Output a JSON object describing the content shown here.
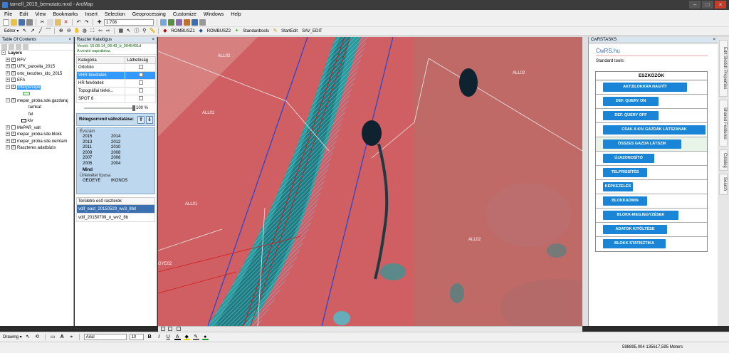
{
  "window": {
    "title": "tarnell_2015_bemutato.mxd - ArcMap"
  },
  "menu": [
    "File",
    "Edit",
    "View",
    "Bookmarks",
    "Insert",
    "Selection",
    "Geoprocessing",
    "Customize",
    "Windows",
    "Help"
  ],
  "toolbar": {
    "scale": "1:708",
    "editor_label": "Editor ▾",
    "rombusz1": "ROMBUSZ1",
    "rombusz2": "ROMBUSZ2",
    "standardtools": "Standardtools",
    "startedit": "StartEdit",
    "sav_edit": "SAV_EDIT"
  },
  "toc": {
    "title": "Table Of Contents",
    "layers_root": "Layers",
    "items": [
      {
        "label": "RFV",
        "checked": true
      },
      {
        "label": "UFK_parcella_2015",
        "checked": true
      },
      {
        "label": "orto_keszites_ido_2015",
        "checked": true
      },
      {
        "label": "EFA",
        "checked": true
      },
      {
        "label": "interpshape",
        "checked": true,
        "selected": true
      },
      {
        "label": "mepar_proba.sde.gazdaraj",
        "checked": true
      },
      {
        "label": "tamkat",
        "indent": true
      },
      {
        "label": "fel",
        "indent": true
      },
      {
        "label": "kiv",
        "indent": true
      },
      {
        "label": "MePAR_valt",
        "checked": true
      },
      {
        "label": "mepar_proba.sde.blokk",
        "checked": true
      },
      {
        "label": "mepar_proba.sde.nemtam",
        "checked": true
      },
      {
        "label": "Raszteres adatbázis",
        "checked": true
      }
    ]
  },
  "catalog": {
    "title": "Raszter Katalógus",
    "version_line1": "Verzió: 15.08.14_08:43_b_9945491d",
    "version_line2": "A verzió naprakész.",
    "col_category": "Kategória",
    "col_visibility": "Láthetóság",
    "rows": [
      {
        "label": "Ortofoto",
        "selected": false
      },
      {
        "label": "VHR felvételek",
        "selected": true
      },
      {
        "label": "HR felvételek",
        "selected": false
      },
      {
        "label": "Topográfiai térké...",
        "selected": false
      },
      {
        "label": "SPOT 6",
        "selected": false
      }
    ],
    "opacity": "100 %",
    "order_title": "Rétegsorrend változtatása:",
    "year_header": "Évszám",
    "years": [
      "2015",
      "2014",
      "2013",
      "2012",
      "2011",
      "2010",
      "2009",
      "2008",
      "2007",
      "2006",
      "2005",
      "2004"
    ],
    "mind": "Mind",
    "type_header": "Ürfelvétel típusa",
    "types": [
      "GEOEYE",
      "IKONOS"
    ],
    "rasters_title": "Területre eső raszterek",
    "rasters": [
      {
        "label": "vdif_east_20150529_wv3_8bit",
        "selected": true
      },
      {
        "label": "vdif_20150709_o_wv2_8b",
        "selected": false
      }
    ]
  },
  "map": {
    "labels": [
      "ALL02",
      "ALL02",
      "ALL02",
      "ALL01",
      "ALL02",
      "GYE02"
    ]
  },
  "cwrs": {
    "title": "CwRSTASKS",
    "brand": "CwRS.hu",
    "standard_tools": "Standard tools:",
    "tools_header": "ESZKÖZÖK",
    "buttons": [
      "AKT.BLOKKRA NAGYÍT",
      "DEF. QUERY ON",
      "DEF. QUERY OFF",
      "CSAK A KIV GAZDÁK LÁTSZANAK",
      "ÖSSZES GAZDA LÁTSZIK",
      "ÚJAZONOSÍTÓ",
      "TELFRISSÍTÉS",
      "KÉPKEZELÉS",
      "BLOKKADMIN",
      "BLOKK-MEGJEGYZÉSEK",
      "ADATOK KITÖLTÉSE",
      "BLOKK STATISZTIKA"
    ]
  },
  "side_tabs": [
    "Edit Sketch Properties",
    "Shared Features",
    "Catalog",
    "Search"
  ],
  "drawing": {
    "label": "Drawing ▾",
    "font": "Arial",
    "size": "10"
  },
  "status": {
    "coords": "598895,004  135617,595 Meters"
  }
}
